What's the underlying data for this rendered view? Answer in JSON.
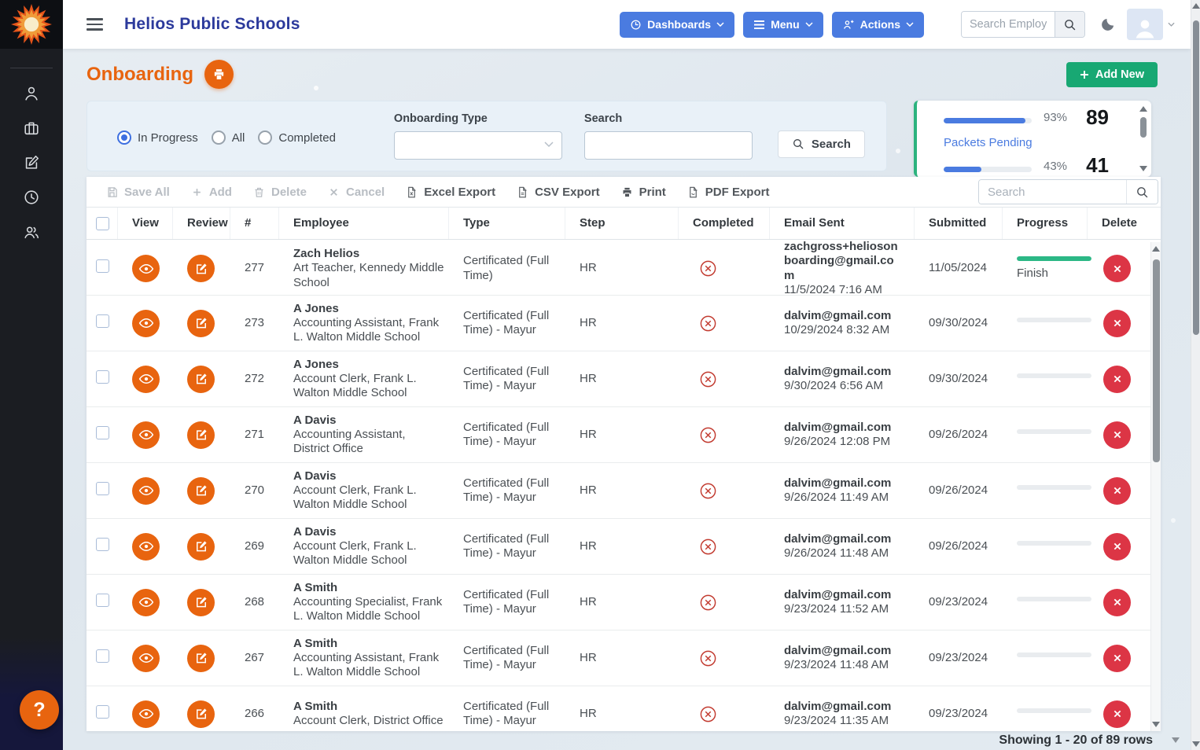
{
  "header": {
    "app_title": "Helios Public Schools",
    "buttons": {
      "dashboards": "Dashboards",
      "menu": "Menu",
      "actions": "Actions"
    },
    "search_placeholder": "Search Employee.."
  },
  "sidebar": {
    "icons": [
      "user-icon",
      "briefcase-icon",
      "compose-icon",
      "clock-icon",
      "users-icon"
    ]
  },
  "page": {
    "title": "Onboarding",
    "add_new_label": "Add New"
  },
  "filters": {
    "radio_in_progress": "In Progress",
    "radio_all": "All",
    "radio_completed": "Completed",
    "onboarding_type_label": "Onboarding Type",
    "search_label": "Search",
    "search_button_label": "Search"
  },
  "stats": {
    "sent": {
      "pct": 93,
      "pct_label": "93%",
      "count": "89"
    },
    "pending": {
      "label": "Packets Pending",
      "pct": 43,
      "pct_label": "43%",
      "count": "41"
    }
  },
  "toolbar": {
    "buttons": [
      {
        "label": "Save All",
        "icon": "save",
        "disabled": true
      },
      {
        "label": "Add",
        "icon": "plus",
        "disabled": true
      },
      {
        "label": "Delete",
        "icon": "trash",
        "disabled": true
      },
      {
        "label": "Cancel",
        "icon": "x",
        "disabled": true
      },
      {
        "label": "Excel Export",
        "icon": "excel",
        "disabled": false
      },
      {
        "label": "CSV Export",
        "icon": "csv",
        "disabled": false
      },
      {
        "label": "Print",
        "icon": "printer",
        "disabled": false
      },
      {
        "label": "PDF Export",
        "icon": "pdf",
        "disabled": false
      }
    ],
    "search_placeholder": "Search"
  },
  "table": {
    "columns": [
      "View",
      "Review",
      "#",
      "Employee",
      "Type",
      "Step",
      "Completed",
      "Email Sent",
      "Submitted",
      "Progress",
      "Delete"
    ],
    "rows": [
      {
        "num": "277",
        "name": "Zach Helios",
        "title": "Art Teacher, Kennedy Middle School",
        "type": "Certificated (Full Time)",
        "step": "HR",
        "completed": false,
        "email": "zachgross+heliosonboarding@gmail.com",
        "email_time": "11/5/2024 7:16 AM",
        "submitted": "11/05/2024",
        "progress_pct": 100,
        "progress_label": "Finish"
      },
      {
        "num": "273",
        "name": "A Jones",
        "title": "Accounting Assistant, Frank L. Walton Middle School",
        "type": "Certificated (Full Time) - Mayur",
        "step": "HR",
        "completed": false,
        "email": "dalvim@gmail.com",
        "email_time": "10/29/2024 8:32 AM",
        "submitted": "09/30/2024",
        "progress_pct": 0,
        "progress_label": ""
      },
      {
        "num": "272",
        "name": "A Jones",
        "title": "Account Clerk, Frank L. Walton Middle School",
        "type": "Certificated (Full Time) - Mayur",
        "step": "HR",
        "completed": false,
        "email": "dalvim@gmail.com",
        "email_time": "9/30/2024 6:56 AM",
        "submitted": "09/30/2024",
        "progress_pct": 0,
        "progress_label": ""
      },
      {
        "num": "271",
        "name": "A Davis",
        "title": "Accounting Assistant, District Office",
        "type": "Certificated (Full Time) - Mayur",
        "step": "HR",
        "completed": false,
        "email": "dalvim@gmail.com",
        "email_time": "9/26/2024 12:08 PM",
        "submitted": "09/26/2024",
        "progress_pct": 0,
        "progress_label": ""
      },
      {
        "num": "270",
        "name": "A Davis",
        "title": "Account Clerk, Frank L. Walton Middle School",
        "type": "Certificated (Full Time) - Mayur",
        "step": "HR",
        "completed": false,
        "email": "dalvim@gmail.com",
        "email_time": "9/26/2024 11:49 AM",
        "submitted": "09/26/2024",
        "progress_pct": 0,
        "progress_label": ""
      },
      {
        "num": "269",
        "name": "A Davis",
        "title": "Account Clerk, Frank L. Walton Middle School",
        "type": "Certificated (Full Time) - Mayur",
        "step": "HR",
        "completed": false,
        "email": "dalvim@gmail.com",
        "email_time": "9/26/2024 11:48 AM",
        "submitted": "09/26/2024",
        "progress_pct": 0,
        "progress_label": ""
      },
      {
        "num": "268",
        "name": "A Smith",
        "title": "Accounting Specialist, Frank L. Walton Middle School",
        "type": "Certificated (Full Time) - Mayur",
        "step": "HR",
        "completed": false,
        "email": "dalvim@gmail.com",
        "email_time": "9/23/2024 11:52 AM",
        "submitted": "09/23/2024",
        "progress_pct": 0,
        "progress_label": ""
      },
      {
        "num": "267",
        "name": "A Smith",
        "title": "Accounting Assistant, Frank L. Walton Middle School",
        "type": "Certificated (Full Time) - Mayur",
        "step": "HR",
        "completed": false,
        "email": "dalvim@gmail.com",
        "email_time": "9/23/2024 11:48 AM",
        "submitted": "09/23/2024",
        "progress_pct": 0,
        "progress_label": ""
      },
      {
        "num": "266",
        "name": "A Smith",
        "title": "Account Clerk, District Office",
        "type": "Certificated (Full Time) - Mayur",
        "step": "HR",
        "completed": false,
        "email": "dalvim@gmail.com",
        "email_time": "9/23/2024 11:35 AM",
        "submitted": "09/23/2024",
        "progress_pct": 0,
        "progress_label": ""
      }
    ]
  },
  "footer": {
    "showing_text": "Showing 1 - 20 of 89 rows"
  },
  "help_button": {
    "glyph": "?"
  },
  "colors": {
    "accent_orange": "#e8640f",
    "accent_blue": "#4a7be0",
    "accent_green": "#18a873",
    "bar_green": "#2cb886",
    "danger_red": "#dc3545",
    "title_navy": "#2c3a9c"
  }
}
